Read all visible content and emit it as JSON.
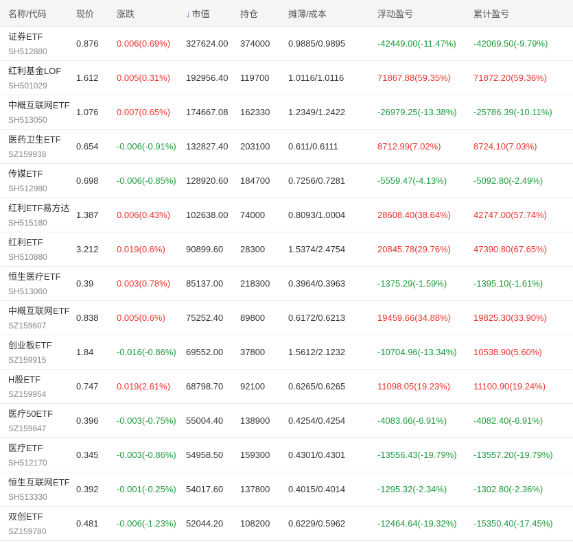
{
  "colors": {
    "up": "#e8322d",
    "down": "#1b9a3a"
  },
  "header": {
    "name": "名称/代码",
    "price": "现价",
    "change": "涨跌",
    "market_value": "市值",
    "position": "持仓",
    "cost": "摊薄/成本",
    "float_pl": "浮动盈亏",
    "acc_pl": "累计盈亏",
    "sort_icon": "arrow-down-icon",
    "sort_glyph": "↓"
  },
  "rows": [
    {
      "name": "证券ETF",
      "code": "SH512880",
      "price": "0.876",
      "change": "0.006(0.69%)",
      "change_dir": "up",
      "mv": "327624.00",
      "pos": "374000",
      "cost": "0.9885/0.9895",
      "float": "-42449.00(-11.47%)",
      "float_dir": "down",
      "acc": "-42069.50(-9.79%)",
      "acc_dir": "down"
    },
    {
      "name": "红利基金LOF",
      "code": "SH501029",
      "price": "1.612",
      "change": "0.005(0.31%)",
      "change_dir": "up",
      "mv": "192956.40",
      "pos": "119700",
      "cost": "1.0116/1.0116",
      "float": "71867.88(59.35%)",
      "float_dir": "up",
      "acc": "71872.20(59.36%)",
      "acc_dir": "up"
    },
    {
      "name": "中概互联网ETF",
      "code": "SH513050",
      "price": "1.076",
      "change": "0.007(0.65%)",
      "change_dir": "up",
      "mv": "174667.08",
      "pos": "162330",
      "cost": "1.2349/1.2422",
      "float": "-26979.25(-13.38%)",
      "float_dir": "down",
      "acc": "-25786.39(-10.11%)",
      "acc_dir": "down"
    },
    {
      "name": "医药卫生ETF",
      "code": "SZ159938",
      "price": "0.654",
      "change": "-0.006(-0.91%)",
      "change_dir": "down",
      "mv": "132827.40",
      "pos": "203100",
      "cost": "0.611/0.6111",
      "float": "8712.99(7.02%)",
      "float_dir": "up",
      "acc": "8724.10(7.03%)",
      "acc_dir": "up"
    },
    {
      "name": "传媒ETF",
      "code": "SH512980",
      "price": "0.698",
      "change": "-0.006(-0.85%)",
      "change_dir": "down",
      "mv": "128920.60",
      "pos": "184700",
      "cost": "0.7256/0.7281",
      "float": "-5559.47(-4.13%)",
      "float_dir": "down",
      "acc": "-5092.80(-2.49%)",
      "acc_dir": "down"
    },
    {
      "name": "红利ETF易方达",
      "code": "SH515180",
      "price": "1.387",
      "change": "0.006(0.43%)",
      "change_dir": "up",
      "mv": "102638.00",
      "pos": "74000",
      "cost": "0.8093/1.0004",
      "float": "28608.40(38.64%)",
      "float_dir": "up",
      "acc": "42747.00(57.74%)",
      "acc_dir": "up"
    },
    {
      "name": "红利ETF",
      "code": "SH510880",
      "price": "3.212",
      "change": "0.019(0.6%)",
      "change_dir": "up",
      "mv": "90899.60",
      "pos": "28300",
      "cost": "1.5374/2.4754",
      "float": "20845.78(29.76%)",
      "float_dir": "up",
      "acc": "47390.80(67.65%)",
      "acc_dir": "up"
    },
    {
      "name": "恒生医疗ETF",
      "code": "SH513060",
      "price": "0.39",
      "change": "0.003(0.78%)",
      "change_dir": "up",
      "mv": "85137.00",
      "pos": "218300",
      "cost": "0.3964/0.3963",
      "float": "-1375.29(-1.59%)",
      "float_dir": "down",
      "acc": "-1395.10(-1.61%)",
      "acc_dir": "down"
    },
    {
      "name": "中概互联网ETF",
      "code": "SZ159607",
      "price": "0.838",
      "change": "0.005(0.6%)",
      "change_dir": "up",
      "mv": "75252.40",
      "pos": "89800",
      "cost": "0.6172/0.6213",
      "float": "19459.66(34.88%)",
      "float_dir": "up",
      "acc": "19825.30(33.90%)",
      "acc_dir": "up"
    },
    {
      "name": "创业板ETF",
      "code": "SZ159915",
      "price": "1.84",
      "change": "-0.016(-0.86%)",
      "change_dir": "down",
      "mv": "69552.00",
      "pos": "37800",
      "cost": "1.5612/2.1232",
      "float": "-10704.96(-13.34%)",
      "float_dir": "down",
      "acc": "10538.90(5.60%)",
      "acc_dir": "up"
    },
    {
      "name": "H股ETF",
      "code": "SZ159954",
      "price": "0.747",
      "change": "0.019(2.61%)",
      "change_dir": "up",
      "mv": "68798.70",
      "pos": "92100",
      "cost": "0.6265/0.6265",
      "float": "11098.05(19.23%)",
      "float_dir": "up",
      "acc": "11100.90(19.24%)",
      "acc_dir": "up"
    },
    {
      "name": "医疗50ETF",
      "code": "SZ159847",
      "price": "0.396",
      "change": "-0.003(-0.75%)",
      "change_dir": "down",
      "mv": "55004.40",
      "pos": "138900",
      "cost": "0.4254/0.4254",
      "float": "-4083.66(-6.91%)",
      "float_dir": "down",
      "acc": "-4082.40(-6.91%)",
      "acc_dir": "down"
    },
    {
      "name": "医疗ETF",
      "code": "SH512170",
      "price": "0.345",
      "change": "-0.003(-0.86%)",
      "change_dir": "down",
      "mv": "54958.50",
      "pos": "159300",
      "cost": "0.4301/0.4301",
      "float": "-13556.43(-19.79%)",
      "float_dir": "down",
      "acc": "-13557.20(-19.79%)",
      "acc_dir": "down"
    },
    {
      "name": "恒生互联网ETF",
      "code": "SH513330",
      "price": "0.392",
      "change": "-0.001(-0.25%)",
      "change_dir": "down",
      "mv": "54017.60",
      "pos": "137800",
      "cost": "0.4015/0.4014",
      "float": "-1295.32(-2.34%)",
      "float_dir": "down",
      "acc": "-1302.80(-2.36%)",
      "acc_dir": "down"
    },
    {
      "name": "双创ETF",
      "code": "SZ159780",
      "price": "0.481",
      "change": "-0.006(-1.23%)",
      "change_dir": "down",
      "mv": "52044.20",
      "pos": "108200",
      "cost": "0.6229/0.5962",
      "float": "-12464.64(-19.32%)",
      "float_dir": "down",
      "acc": "-15350.40(-17.45%)",
      "acc_dir": "down"
    }
  ]
}
